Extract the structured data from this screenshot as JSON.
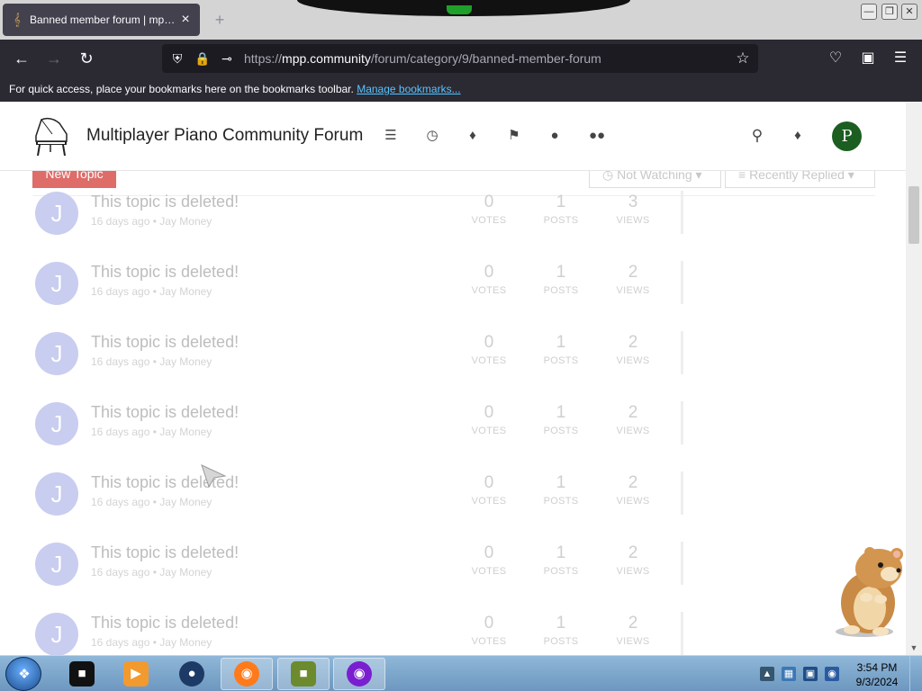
{
  "browser": {
    "tab": {
      "title": "Banned member forum | mpp.c",
      "close": "×"
    },
    "new_tab": "+",
    "url": {
      "scheme": "https://",
      "host": "mpp.community",
      "path": "/forum/category/9/banned-member-forum"
    },
    "bookmarks_bar": {
      "text": "For quick access, place your bookmarks here on the bookmarks toolbar.",
      "link": "Manage bookmarks..."
    }
  },
  "site": {
    "title": "Multiplayer Piano Community Forum",
    "header_icons": [
      "categories-icon",
      "recent-icon",
      "popular-icon",
      "tags-icon",
      "users-icon",
      "groups-icon"
    ],
    "user_avatar_letter": "P"
  },
  "controls": {
    "new_topic": "New Topic",
    "watch": "Not Watching",
    "sort": "Recently Replied"
  },
  "topics": [
    {
      "avatar": "J",
      "title": "This topic is deleted!",
      "age": "16 days ago",
      "author": "Jay Money",
      "votes": "0",
      "posts": "1",
      "views": "3"
    },
    {
      "avatar": "J",
      "title": "This topic is deleted!",
      "age": "16 days ago",
      "author": "Jay Money",
      "votes": "0",
      "posts": "1",
      "views": "2"
    },
    {
      "avatar": "J",
      "title": "This topic is deleted!",
      "age": "16 days ago",
      "author": "Jay Money",
      "votes": "0",
      "posts": "1",
      "views": "2"
    },
    {
      "avatar": "J",
      "title": "This topic is deleted!",
      "age": "16 days ago",
      "author": "Jay Money",
      "votes": "0",
      "posts": "1",
      "views": "2"
    },
    {
      "avatar": "J",
      "title": "This topic is deleted!",
      "age": "16 days ago",
      "author": "Jay Money",
      "votes": "0",
      "posts": "1",
      "views": "2"
    },
    {
      "avatar": "J",
      "title": "This topic is deleted!",
      "age": "16 days ago",
      "author": "Jay Money",
      "votes": "0",
      "posts": "1",
      "views": "2"
    },
    {
      "avatar": "J",
      "title": "This topic is deleted!",
      "age": "16 days ago",
      "author": "Jay Money",
      "votes": "0",
      "posts": "1",
      "views": "2"
    }
  ],
  "stat_labels": {
    "votes": "VOTES",
    "posts": "POSTS",
    "views": "VIEWS"
  },
  "separator": " • ",
  "taskbar": {
    "time": "3:54 PM",
    "date": "9/3/2024"
  },
  "colors": {
    "new_topic_button": "#d9534f",
    "user_avatar": "#1b5e20",
    "topic_avatar": "#c9cdf0"
  }
}
